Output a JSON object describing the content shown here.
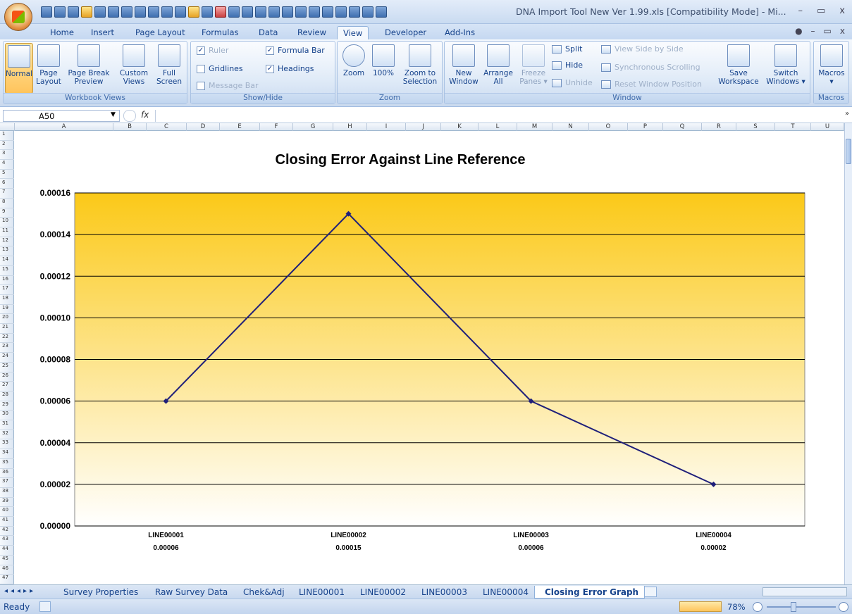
{
  "window": {
    "title": "DNA Import Tool New Ver 1.99.xls  [Compatibility Mode] - Mi...",
    "min": "–",
    "restore": "▭",
    "close": "x"
  },
  "ribbon_tabs": [
    "Home",
    "Insert",
    "Page Layout",
    "Formulas",
    "Data",
    "Review",
    "View",
    "Developer",
    "Add-Ins"
  ],
  "active_tab": "View",
  "workbook_views": {
    "normal": "Normal",
    "page_layout_1": "Page",
    "page_layout_2": "Layout",
    "page_break_1": "Page Break",
    "page_break_2": "Preview",
    "custom_1": "Custom",
    "custom_2": "Views",
    "full_1": "Full",
    "full_2": "Screen",
    "label": "Workbook Views"
  },
  "show_hide": {
    "ruler": "Ruler",
    "gridlines": "Gridlines",
    "message_bar": "Message Bar",
    "formula_bar": "Formula Bar",
    "headings": "Headings",
    "label": "Show/Hide",
    "ruler_checked": "✓",
    "formula_bar_checked": "✓",
    "headings_checked": "✓"
  },
  "zoom_group": {
    "zoom": "Zoom",
    "pct100": "100%",
    "zoom_sel_1": "Zoom to",
    "zoom_sel_2": "Selection",
    "label": "Zoom"
  },
  "window_group": {
    "new_1": "New",
    "new_2": "Window",
    "arrange_1": "Arrange",
    "arrange_2": "All",
    "freeze_1": "Freeze",
    "freeze_2": "Panes ▾",
    "split": "Split",
    "hide": "Hide",
    "unhide": "Unhide",
    "side_by_side": "View Side by Side",
    "sync": "Synchronous Scrolling",
    "reset": "Reset Window Position",
    "save_1": "Save",
    "save_2": "Workspace",
    "switch_1": "Switch",
    "switch_2": "Windows ▾",
    "label": "Window"
  },
  "macros_group": {
    "macros": "Macros",
    "arrow": "▾",
    "label": "Macros"
  },
  "formula_bar": {
    "name_box": "A50",
    "fx": "fx"
  },
  "columns": [
    "A",
    "B",
    "C",
    "D",
    "E",
    "F",
    "G",
    "H",
    "I",
    "J",
    "K",
    "L",
    "M",
    "N",
    "O",
    "P",
    "Q",
    "R",
    "S",
    "T",
    "U"
  ],
  "rows": [
    "1",
    "2",
    "3",
    "4",
    "5",
    "6",
    "7",
    "8",
    "9",
    "10",
    "11",
    "12",
    "13",
    "14",
    "15",
    "16",
    "17",
    "18",
    "19",
    "20",
    "21",
    "22",
    "23",
    "24",
    "25",
    "26",
    "27",
    "28",
    "29",
    "30",
    "31",
    "32",
    "33",
    "34",
    "35",
    "36",
    "37",
    "38",
    "39",
    "40",
    "41",
    "42",
    "43",
    "44",
    "45",
    "46",
    "47"
  ],
  "sheet_tabs": [
    "Survey Properties",
    "Raw Survey Data",
    "Chek&Adj",
    "LINE00001",
    "LINE00002",
    "LINE00003",
    "LINE00004",
    "Closing Error Graph"
  ],
  "active_sheet": "Closing Error Graph",
  "status": {
    "ready": "Ready",
    "zoom": "78%"
  },
  "chart_data": {
    "type": "line",
    "title": "Closing Error Against Line Reference",
    "categories": [
      "LINE00001",
      "LINE00002",
      "LINE00003",
      "LINE00004"
    ],
    "category_sublabels": [
      "0.00006",
      "0.00015",
      "0.00006",
      "0.00002"
    ],
    "values": [
      6e-05,
      0.00015,
      6e-05,
      2e-05
    ],
    "ylim": [
      0,
      0.00016
    ],
    "yticks": [
      "0.00000",
      "0.00002",
      "0.00004",
      "0.00006",
      "0.00008",
      "0.00010",
      "0.00012",
      "0.00014",
      "0.00016"
    ],
    "grid": true,
    "line_color": "#1f1f7a",
    "plot_gradient_top": "#fbc918",
    "plot_gradient_bottom": "#ffffff"
  }
}
